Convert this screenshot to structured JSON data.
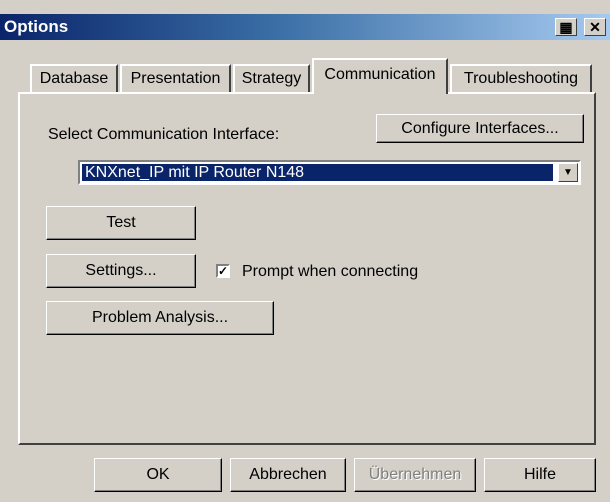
{
  "window": {
    "title": "Options"
  },
  "tabs": [
    {
      "label": "Database"
    },
    {
      "label": "Presentation"
    },
    {
      "label": "Strategy"
    },
    {
      "label": "Communication",
      "active": true
    },
    {
      "label": "Troubleshooting"
    }
  ],
  "communication": {
    "select_label": "Select Communication Interface:",
    "configure_button": "Configure Interfaces...",
    "interface_value": "KNXnet_IP mit IP Router N148",
    "test_button": "Test",
    "settings_button": "Settings...",
    "prompt_checkbox_label": "Prompt when connecting",
    "prompt_checked": true,
    "problem_button": "Problem Analysis..."
  },
  "footer": {
    "ok": "OK",
    "cancel": "Abbrechen",
    "apply": "Übernehmen",
    "help": "Hilfe"
  },
  "icons": {
    "help_icon": "help-icon",
    "close_icon": "close-icon"
  }
}
